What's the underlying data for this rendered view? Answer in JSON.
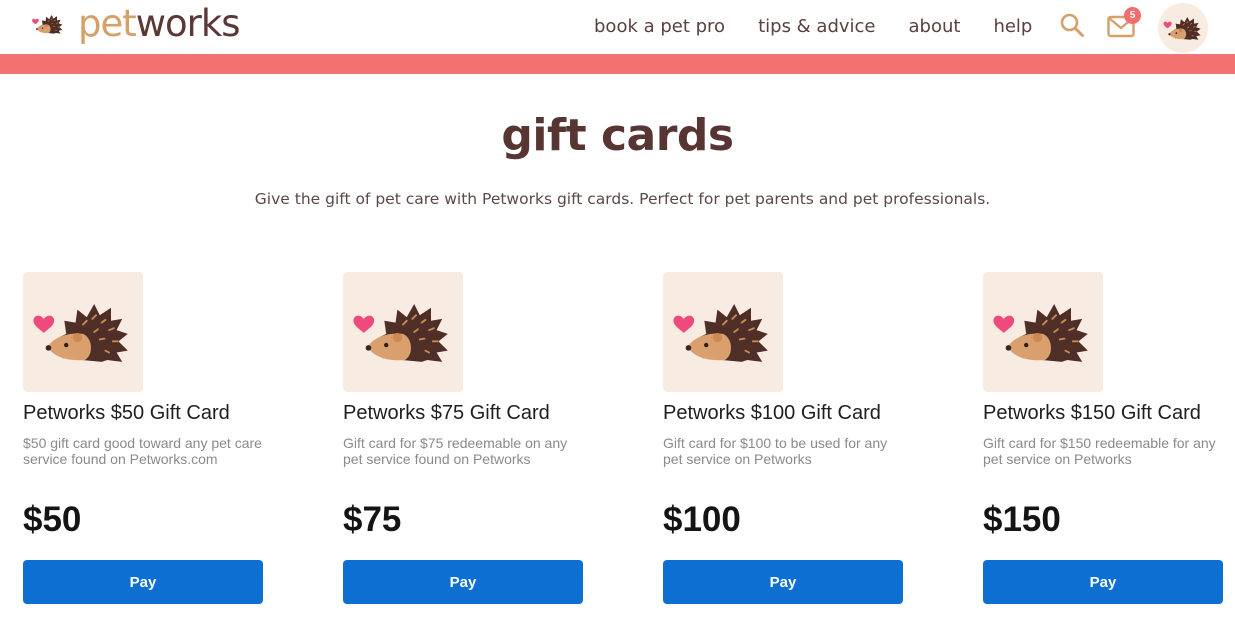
{
  "header": {
    "logo": {
      "part1": "pet",
      "part2": "works"
    },
    "nav": [
      {
        "label": "book a pet pro"
      },
      {
        "label": "tips & advice"
      },
      {
        "label": "about"
      },
      {
        "label": "help"
      }
    ],
    "notifications_count": "5",
    "icons": [
      "search-icon",
      "mail-icon",
      "user-avatar"
    ]
  },
  "page": {
    "title": "gift cards",
    "subtitle": "Give the gift of pet care with Petworks gift cards. Perfect for pet parents and pet professionals."
  },
  "cards": [
    {
      "name": "Petworks $50 Gift Card",
      "description": "$50 gift card good toward any pet care service found on Petworks.com",
      "price": "$50",
      "button": "Pay"
    },
    {
      "name": "Petworks $75 Gift Card",
      "description": "Gift card for $75 redeemable on any pet service found on Petworks",
      "price": "$75",
      "button": "Pay"
    },
    {
      "name": "Petworks $100 Gift Card",
      "description": "Gift card for $100 to be used for any pet service on Petworks",
      "price": "$100",
      "button": "Pay"
    },
    {
      "name": "Petworks $150 Gift Card",
      "description": "Gift card for $150 redeemable for any pet service on Petworks",
      "price": "$150",
      "button": "Pay"
    }
  ],
  "colors": {
    "accent_bar": "#f27272",
    "title": "#573533",
    "logo_pet": "#d6a06a",
    "logo_works": "#5a3836",
    "button": "#0e6fd2",
    "card_bg": "#f7ebe2"
  }
}
